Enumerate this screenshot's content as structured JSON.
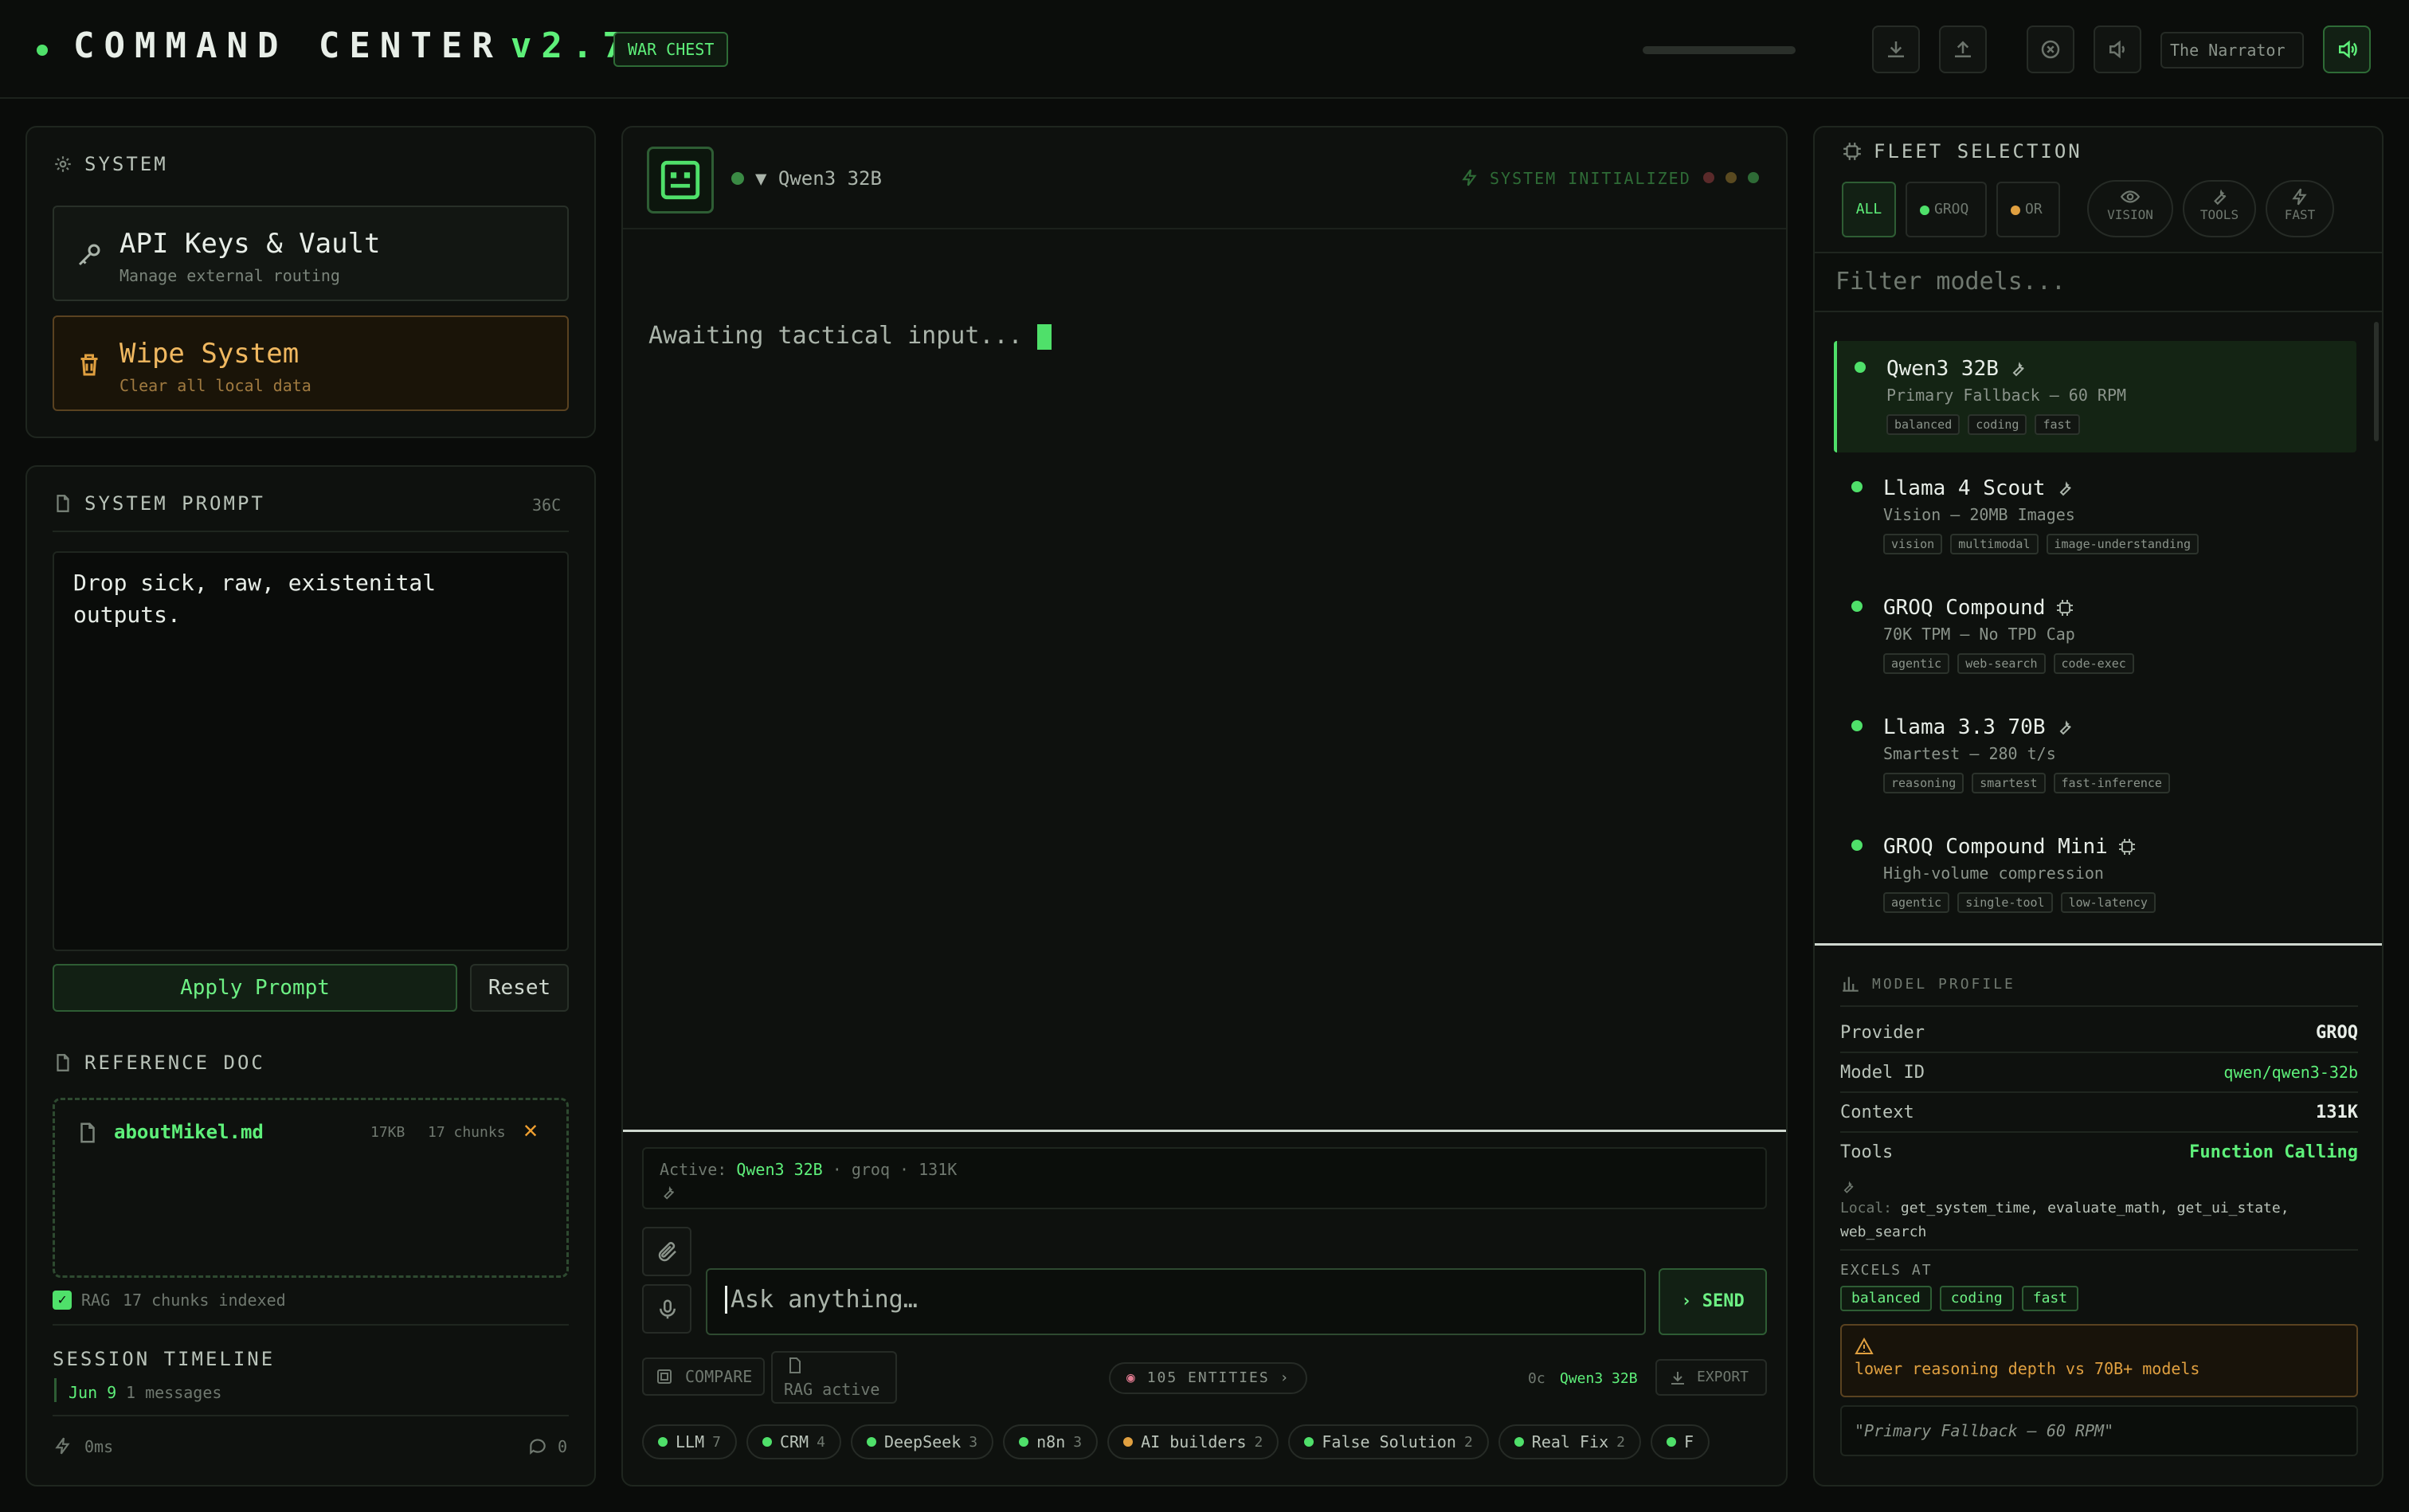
{
  "header": {
    "title": "COMMAND CENTER",
    "version": "v2.7",
    "badge": "WAR CHEST",
    "narrator": "The Narrator"
  },
  "system": {
    "title": "SYSTEM",
    "api_title": "API Keys & Vault",
    "api_sub": "Manage external routing",
    "wipe_title": "Wipe System",
    "wipe_sub": "Clear all local data"
  },
  "prompt": {
    "title": "SYSTEM PROMPT",
    "count": "36C",
    "text": "Drop sick, raw, existenital outputs.",
    "apply": "Apply Prompt",
    "reset": "Reset"
  },
  "reference": {
    "title": "REFERENCE DOC",
    "file": "aboutMikel.md",
    "size": "17KB",
    "chunks": "17 chunks",
    "rag_label": "RAG",
    "rag_status": "17 chunks indexed"
  },
  "timeline": {
    "title": "SESSION TIMELINE",
    "date": "Jun 9",
    "messages": "1 messages",
    "latency": "0ms",
    "comments": "0"
  },
  "chat": {
    "model": "Qwen3 32B",
    "status": "SYSTEM INITIALIZED",
    "awaiting": "Awaiting tactical input...",
    "active_label": "Active:",
    "active_model": "Qwen3 32B",
    "active_provider": "groq",
    "active_ctx": "131K",
    "placeholder": "Ask anything…",
    "send": "SEND",
    "compare": "COMPARE",
    "rag_active": "RAG active",
    "entities": "105 ENTITIES",
    "chars": "0c",
    "footer_model": "Qwen3 32B",
    "export": "EXPORT",
    "chips": [
      {
        "label": "LLM",
        "n": "7",
        "c": "g"
      },
      {
        "label": "CRM",
        "n": "4",
        "c": "g"
      },
      {
        "label": "DeepSeek",
        "n": "3",
        "c": "g"
      },
      {
        "label": "n8n",
        "n": "3",
        "c": "g"
      },
      {
        "label": "AI builders",
        "n": "2",
        "c": "or"
      },
      {
        "label": "False Solution",
        "n": "2",
        "c": "g"
      },
      {
        "label": "Real Fix",
        "n": "2",
        "c": "g"
      },
      {
        "label": "F",
        "n": "",
        "c": "g"
      }
    ]
  },
  "fleet": {
    "title": "FLEET SELECTION",
    "filters": [
      "ALL",
      "GROQ",
      "OR"
    ],
    "caps": [
      "VISION",
      "TOOLS",
      "FAST"
    ],
    "search_placeholder": "Filter models...",
    "models": [
      {
        "name": "Qwen3 32B",
        "desc": "Primary Fallback — 60 RPM",
        "tags": [
          "balanced",
          "coding",
          "fast"
        ],
        "icon": "wrench-icon"
      },
      {
        "name": "Llama 4 Scout",
        "desc": "Vision — 20MB Images",
        "tags": [
          "vision",
          "multimodal",
          "image-understanding"
        ],
        "icon": "wrench-icon"
      },
      {
        "name": "GROQ Compound",
        "desc": "70K TPM — No TPD Cap",
        "tags": [
          "agentic",
          "web-search",
          "code-exec"
        ],
        "icon": "chip-icon"
      },
      {
        "name": "Llama 3.3 70B",
        "desc": "Smartest — 280 t/s",
        "tags": [
          "reasoning",
          "smartest",
          "fast-inference"
        ],
        "icon": "wrench-icon"
      },
      {
        "name": "GROQ Compound Mini",
        "desc": "High-volume compression",
        "tags": [
          "agentic",
          "single-tool",
          "low-latency"
        ],
        "icon": "chip-icon"
      }
    ]
  },
  "profile": {
    "title": "MODEL PROFILE",
    "rows": [
      {
        "k": "Provider",
        "v": "GROQ"
      },
      {
        "k": "Model ID",
        "v": "qwen/qwen3-32b"
      },
      {
        "k": "Context",
        "v": "131K"
      },
      {
        "k": "Tools",
        "v": "Function Calling"
      }
    ],
    "local_label": "Local:",
    "local_tools": "get_system_time, evaluate_math, get_ui_state, web_search",
    "excels_title": "EXCELS AT",
    "excels": [
      "balanced",
      "coding",
      "fast"
    ],
    "warning": "lower reasoning depth vs 70B+ models",
    "quote": "\"Primary Fallback — 60 RPM\""
  }
}
